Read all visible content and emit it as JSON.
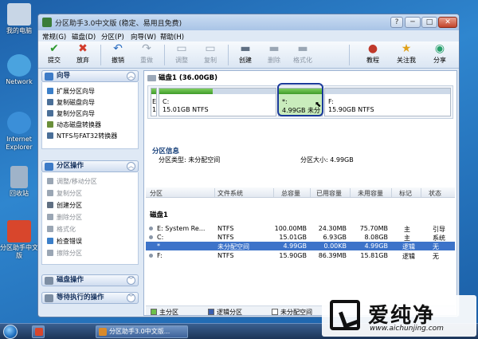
{
  "desktop": {
    "icons": [
      {
        "label": "我的电脑",
        "icon": "computer-icon",
        "color": "#c8d6e6"
      },
      {
        "label": "Network",
        "icon": "network-icon",
        "color": "#4aa3df"
      },
      {
        "label": "Internet Explorer",
        "icon": "ie-icon",
        "color": "#3b8fd8"
      },
      {
        "label": "回收站",
        "icon": "recycle-bin-icon",
        "color": "#9fb3c9"
      },
      {
        "label": "分区助手中文版",
        "icon": "partition-assistant-icon",
        "color": "#d8462c"
      }
    ]
  },
  "window": {
    "title": "分区助手3.0中文版 (稳定、易用且免费)",
    "buttons": {
      "help": "?",
      "minimize": "─",
      "maximize": "□",
      "close": "✕"
    }
  },
  "menu": [
    "常规(G)",
    "磁盘(D)",
    "分区(P)",
    "向导(W)",
    "帮助(H)"
  ],
  "toolbar": [
    {
      "label": "提交",
      "icon": "checkmark-icon",
      "glyph": "✔",
      "color": "#2e9a2e",
      "enabled": true
    },
    {
      "label": "放弃",
      "icon": "discard-icon",
      "glyph": "✖",
      "color": "#d23b2b",
      "enabled": true
    },
    {
      "label": "撤销",
      "icon": "undo-icon",
      "glyph": "↶",
      "color": "#2a6cc0",
      "enabled": true
    },
    {
      "label": "重做",
      "icon": "redo-icon",
      "glyph": "↷",
      "color": "#9aa6b4",
      "enabled": false
    },
    {
      "label": "调整",
      "icon": "resize-icon",
      "glyph": "▭",
      "color": "#9aa6b4",
      "enabled": false
    },
    {
      "label": "复制",
      "icon": "copy-icon",
      "glyph": "▭",
      "color": "#9aa6b4",
      "enabled": false
    },
    {
      "label": "创建",
      "icon": "create-icon",
      "glyph": "▬",
      "color": "#5f6f82",
      "enabled": true
    },
    {
      "label": "删除",
      "icon": "delete-icon",
      "glyph": "▬",
      "color": "#9aa6b4",
      "enabled": false
    },
    {
      "label": "格式化",
      "icon": "format-icon",
      "glyph": "▬",
      "color": "#9aa6b4",
      "enabled": false
    },
    {
      "label": "教程",
      "icon": "tutorial-icon",
      "glyph": "●",
      "color": "#c0392b",
      "enabled": true
    },
    {
      "label": "关注我",
      "icon": "follow-icon",
      "glyph": "★",
      "color": "#e0a11b",
      "enabled": true
    },
    {
      "label": "分享",
      "icon": "share-icon",
      "glyph": "◉",
      "color": "#27a06b",
      "enabled": true
    }
  ],
  "sidebar": {
    "wizard": {
      "title": "向导",
      "items": [
        {
          "label": "扩展分区向导",
          "enabled": true,
          "color": "#3b7fc9"
        },
        {
          "label": "复制磁盘向导",
          "enabled": true,
          "color": "#4a6f98"
        },
        {
          "label": "复制分区向导",
          "enabled": true,
          "color": "#4a6f98"
        },
        {
          "label": "动态磁盘转换器",
          "enabled": true,
          "color": "#6a8f3a"
        },
        {
          "label": "NTFS与FAT32转换器",
          "enabled": true,
          "color": "#4a6f98"
        }
      ]
    },
    "partition_ops": {
      "title": "分区操作",
      "items": [
        {
          "label": "调整/移动分区",
          "enabled": false,
          "color": "#9aa6b4"
        },
        {
          "label": "复制分区",
          "enabled": false,
          "color": "#9aa6b4"
        },
        {
          "label": "创建分区",
          "enabled": true,
          "color": "#5f6f82"
        },
        {
          "label": "删除分区",
          "enabled": false,
          "color": "#9aa6b4"
        },
        {
          "label": "格式化",
          "enabled": false,
          "color": "#9aa6b4"
        },
        {
          "label": "检查错误",
          "enabled": true,
          "color": "#3b7fc9"
        },
        {
          "label": "擦除分区",
          "enabled": false,
          "color": "#9aa6b4"
        }
      ]
    },
    "disk_ops": {
      "title": "磁盘操作"
    },
    "pending_ops": {
      "title": "等待执行的操作"
    }
  },
  "disk": {
    "header": "磁盘1 (36.00GB)",
    "map": [
      {
        "letter": "E",
        "letter2": "1",
        "name": "",
        "size": "",
        "fill_pct": 100
      },
      {
        "letter": "",
        "name": "C:",
        "size": "15.01GB NTFS",
        "fill_pct": 46
      },
      {
        "letter": "",
        "name": "*:",
        "size": "4.99GB 未分",
        "fill_pct": 100,
        "selected": true
      },
      {
        "letter": "",
        "name": "F:",
        "size": "15.90GB NTFS",
        "fill_pct": 0
      }
    ]
  },
  "partition_info": {
    "title": "分区信息",
    "type_label": "分区类型: 未分配空间",
    "size_label": "分区大小: 4.99GB"
  },
  "table": {
    "headers": [
      "分区",
      "文件系统",
      "总容量",
      "已用容量",
      "未用容量",
      "标记",
      "状态"
    ],
    "group": "磁盘1",
    "rows": [
      {
        "name": "E: System Re...",
        "fs": "NTFS",
        "total": "100.00MB",
        "used": "24.30MB",
        "free": "75.70MB",
        "flag": "主",
        "status": "引导",
        "selected": false
      },
      {
        "name": "C:",
        "fs": "NTFS",
        "total": "15.01GB",
        "used": "6.93GB",
        "free": "8.08GB",
        "flag": "主",
        "status": "系统",
        "selected": false
      },
      {
        "name": "*",
        "fs": "未分配空间",
        "total": "4.99GB",
        "used": "0.00KB",
        "free": "4.99GB",
        "flag": "逻辑",
        "status": "无",
        "selected": true
      },
      {
        "name": "F:",
        "fs": "NTFS",
        "total": "15.90GB",
        "used": "86.39MB",
        "free": "15.81GB",
        "flag": "逻辑",
        "status": "无",
        "selected": false
      }
    ]
  },
  "legend": [
    {
      "label": "主分区",
      "color": "#6cc04a"
    },
    {
      "label": "逻辑分区",
      "color": "#3a5fb0"
    },
    {
      "label": "未分配空间",
      "color": "#ffffff"
    }
  ],
  "taskbar": {
    "items": [
      "分区助手3.0中文版..."
    ]
  },
  "watermark": {
    "brand": "爱纯净",
    "url": "www.aichunjing.com"
  }
}
